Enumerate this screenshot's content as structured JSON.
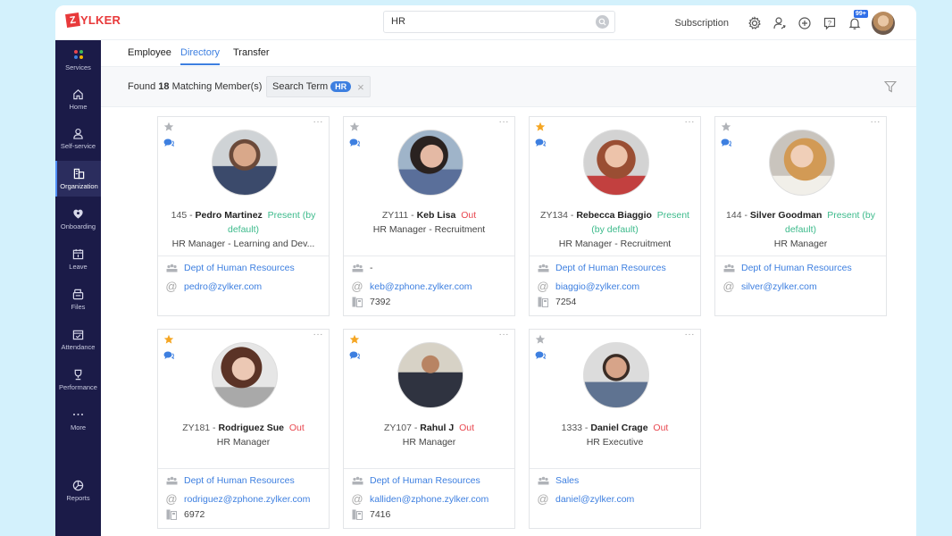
{
  "app": {
    "logo_letter": "Z",
    "logo_text": "YLKER",
    "brand_color": "#e8393a",
    "accent_color": "#3d7fe0"
  },
  "header": {
    "search_value": "HR",
    "subscription_label": "Subscription",
    "notification_badge": "99+",
    "icons": [
      "settings-icon",
      "user-switch-icon",
      "add-icon",
      "help-icon",
      "bell-icon"
    ]
  },
  "sidebar": {
    "items": [
      {
        "label": "Services",
        "icon": "services-dots-icon"
      },
      {
        "label": "Home",
        "icon": "home-icon"
      },
      {
        "label": "Self-service",
        "icon": "person-icon"
      },
      {
        "label": "Organization",
        "icon": "organization-icon",
        "active": true
      },
      {
        "label": "Onboarding",
        "icon": "onboarding-icon"
      },
      {
        "label": "Leave",
        "icon": "calendar-icon"
      },
      {
        "label": "Files",
        "icon": "files-icon"
      },
      {
        "label": "Attendance",
        "icon": "attendance-icon"
      },
      {
        "label": "Performance",
        "icon": "trophy-icon"
      },
      {
        "label": "More",
        "icon": "more-dots-icon"
      },
      {
        "label": "Reports",
        "icon": "pie-chart-icon"
      }
    ]
  },
  "tabs": [
    {
      "label": "Employee",
      "active": false
    },
    {
      "label": "Directory",
      "active": true
    },
    {
      "label": "Transfer",
      "active": false
    }
  ],
  "filter": {
    "found_prefix": "Found",
    "found_count": "18",
    "found_suffix": "Matching Member(s)",
    "chip_label": "Search Term",
    "chip_value": "HR",
    "chip_close": "×"
  },
  "employees": [
    {
      "id": "145",
      "name": "Pedro Martinez",
      "status": "Present (by default)",
      "status_type": "present",
      "designation": "HR Manager - Learning and Dev...",
      "department": "Dept of Human Resources",
      "email": "pedro@zylker.com",
      "phone": "",
      "starred": false
    },
    {
      "id": "ZY111",
      "name": "Keb Lisa",
      "status": "Out",
      "status_type": "out",
      "designation": "HR Manager - Recruitment",
      "department": "-",
      "email": "keb@zphone.zylker.com",
      "phone": "7392",
      "starred": false
    },
    {
      "id": "ZY134",
      "name": "Rebecca Biaggio",
      "status": "Present (by default)",
      "status_type": "present",
      "designation": "HR Manager - Recruitment",
      "department": "Dept of Human Resources",
      "email": "biaggio@zylker.com",
      "phone": "7254",
      "starred": true
    },
    {
      "id": "144",
      "name": "Silver Goodman",
      "status": "Present (by default)",
      "status_type": "present",
      "designation": "HR Manager",
      "department": "Dept of Human Resources",
      "email": "silver@zylker.com",
      "phone": "",
      "starred": false
    },
    {
      "id": "ZY181",
      "name": "Rodriguez Sue",
      "status": "Out",
      "status_type": "out",
      "designation": "HR Manager",
      "department": "Dept of Human Resources",
      "email": "rodriguez@zphone.zylker.com",
      "phone": "6972",
      "starred": true
    },
    {
      "id": "ZY107",
      "name": "Rahul J",
      "status": "Out",
      "status_type": "out",
      "designation": "HR Manager",
      "department": "Dept of Human Resources",
      "email": "kalliden@zphone.zylker.com",
      "phone": "7416",
      "starred": true
    },
    {
      "id": "1333",
      "name": "Daniel Crage",
      "status": "Out",
      "status_type": "out",
      "designation": "HR Executive",
      "department": "Sales",
      "email": "daniel@zylker.com",
      "phone": "",
      "starred": false
    }
  ],
  "card_labels": {
    "separator": " - ",
    "more": "···"
  }
}
